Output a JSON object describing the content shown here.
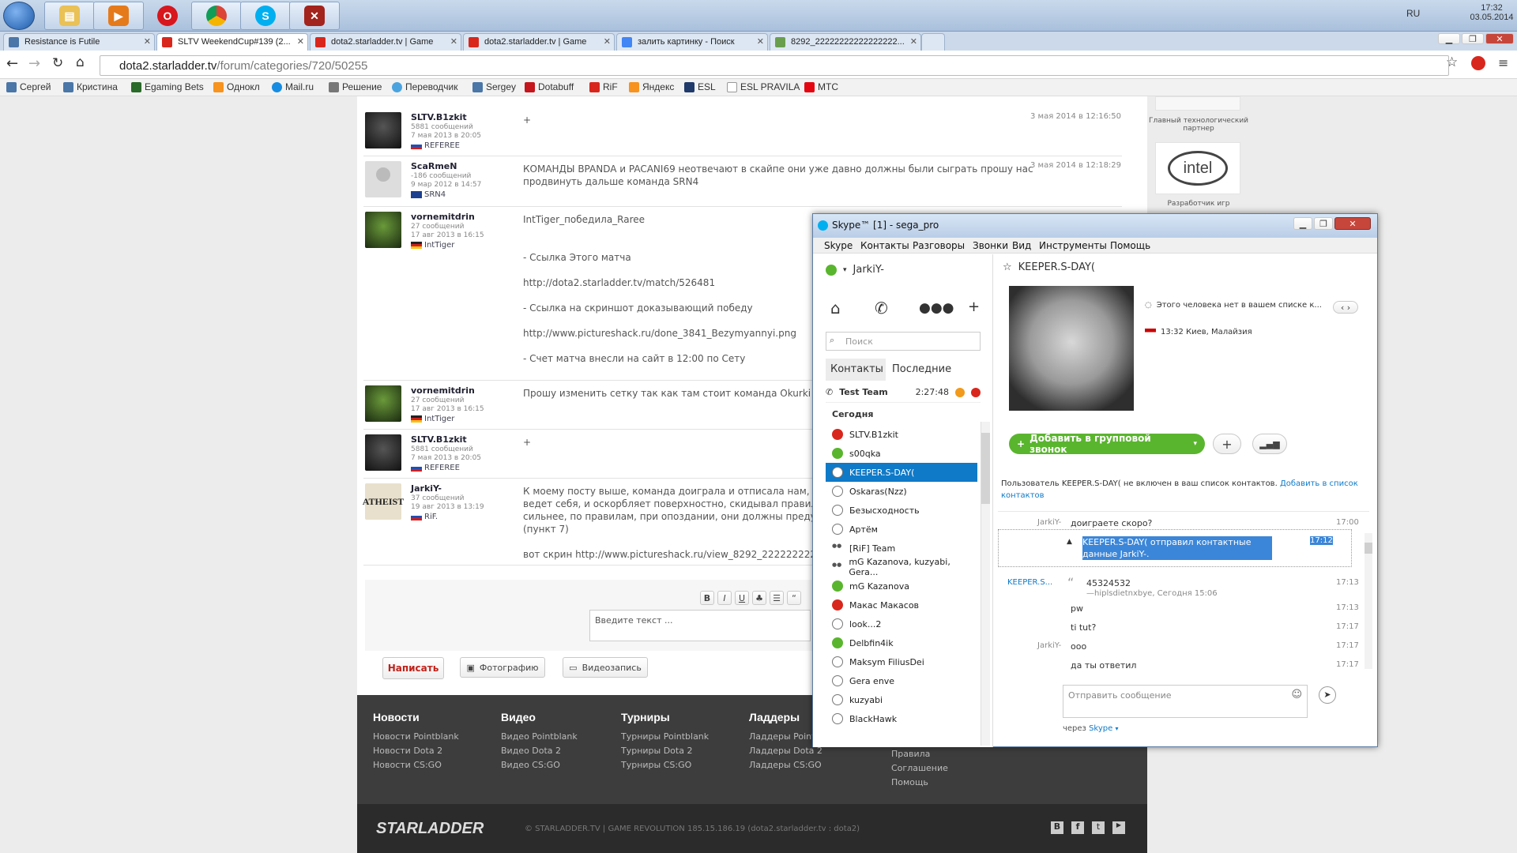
{
  "taskbar": {
    "lang": "RU",
    "time": "17:32",
    "date": "03.05.2014"
  },
  "tabs": [
    {
      "label": "Resistance is Futile"
    },
    {
      "label": "SLTV WeekendCup#139 (2..."
    },
    {
      "label": "dota2.starladder.tv | Game"
    },
    {
      "label": "dota2.starladder.tv | Game"
    },
    {
      "label": "залить картинку - Поиск"
    },
    {
      "label": "8292_22222222222222222..."
    }
  ],
  "address": {
    "host": "dota2.starladder.tv",
    "path": "/forum/categories/720/50255"
  },
  "bookmarks": [
    "Сергей",
    "Кристина",
    "Egaming Bets",
    "Однокл",
    "Mail.ru",
    "Решение",
    "Переводчик",
    "Sergey",
    "Dotabuff",
    "RiF",
    "Яндекс",
    "ESL",
    "ESL PRAVILA",
    "MTC"
  ],
  "sidebar": {
    "partner1": "Главный технологический партнер",
    "partner2": "Разработчик игр"
  },
  "posts": [
    {
      "user": "SLTV.B1zkit",
      "count": "5881 сообщений",
      "date": "7 мая 2013 в 20:05",
      "team": "REFEREE",
      "text": "+",
      "posted": "3 мая 2014 в 12:16:50"
    },
    {
      "user": "ScaRmeN",
      "count": "-186 сообщений",
      "date": "9 мар 2012 в 14:57",
      "team": "SRN4",
      "text": "КОМАНДЫ BPANDA и PACANI69 неотвечают в скайпе они уже давно должны были сыграть прошу нас\nпродвинуть дальше команда SRN4",
      "posted": "3 мая 2014 в 12:18:29"
    },
    {
      "user": "vornemitdrin",
      "count": "27 сообщений",
      "date": "17 авг 2013 в 16:15",
      "team": "IntTiger",
      "text": "IntTiger_победила_Raree\n\n\n- Ссылка Этого матча\n\nhttp://dota2.starladder.tv/match/526481\n\n- Ссылка на скриншот доказывающий победу\n\nhttp://www.pictureshack.ru/done_3841_Bezymyannyi.png\n\n- Счет матча внесли на сайт в 12:00 по Сету",
      "posted": ""
    },
    {
      "user": "vornemitdrin",
      "count": "27 сообщений",
      "date": "17 авг 2013 в 16:15",
      "team": "IntTiger",
      "text": "Прошу изменить сетку так как там стоит команда Okurki",
      "posted": ""
    },
    {
      "user": "SLTV.B1zkit",
      "count": "5881 сообщений",
      "date": "7 мая 2013 в 20:05",
      "team": "REFEREE",
      "text": "+",
      "posted": ""
    },
    {
      "user": "JarkiY-",
      "count": "37 сообщений",
      "date": "19 авг 2013 в 13:19",
      "team": "RiF.",
      "text": "К моему посту выше, команда доиграла и отписала нам, когда у\nведет себя, и оскорбляет поверхностно, скидывал правила ем\nсильнее, по правилам, при опоздании, они должны предупред\n(пункт 7)\n\nвот скрин http://www.pictureshack.ru/view_8292_2222222222",
      "posted": ""
    }
  ],
  "editor": {
    "placeholder": "Введите текст ...",
    "submit": "Написать",
    "photo": "Фотографию",
    "video": "Видеозапись"
  },
  "footer": {
    "cols": [
      {
        "title": "Новости",
        "items": [
          "Новости Pointblank",
          "Новости Dota 2",
          "Новости CS:GO"
        ]
      },
      {
        "title": "Видео",
        "items": [
          "Видео Pointblank",
          "Видео Dota 2",
          "Видео CS:GO"
        ]
      },
      {
        "title": "Турниры",
        "items": [
          "Турниры Pointblank",
          "Турниры Dota 2",
          "Турниры CS:GO"
        ]
      },
      {
        "title": "Ладдеры",
        "items": [
          "Ладдеры Pointblank",
          "Ладдеры Dota 2",
          "Ладдеры CS:GO"
        ]
      }
    ],
    "extra": [
      "Правила",
      "Соглашение",
      "Помощь"
    ],
    "copyright": "© STARLADDER.TV | GAME REVOLUTION 185.15.186.19 (dota2.starladder.tv : dota2)",
    "logo": "STARLADDER"
  },
  "skype": {
    "title": "Skype™ [1] - sega_pro",
    "menu": [
      "Skype",
      "Контакты",
      "Разговоры",
      "Звонки",
      "Вид",
      "Инструменты",
      "Помощь"
    ],
    "me": "JarkiY-",
    "search_placeholder": "Поиск",
    "tab_contacts": "Контакты",
    "tab_recent": "Последние",
    "group": {
      "name": "Test Team",
      "time": "2:27:48"
    },
    "today": "Сегодня",
    "contacts": [
      {
        "name": "SLTV.B1zkit",
        "status": "red"
      },
      {
        "name": "s00qka",
        "status": "green"
      },
      {
        "name": "KEEPER.S-DAY(",
        "status": "unknown"
      },
      {
        "name": "Oskaras(Nzz)",
        "status": "unknown"
      },
      {
        "name": "Безысходность",
        "status": "unknown"
      },
      {
        "name": "Артём",
        "status": "unknown"
      },
      {
        "name": "[RiF] Team",
        "status": "group"
      },
      {
        "name": "mG Kazanova, kuzyabi, Gera...",
        "status": "group"
      },
      {
        "name": "mG Kazanova",
        "status": "green"
      },
      {
        "name": "Макас Макасов",
        "status": "red"
      },
      {
        "name": "look...2",
        "status": "unknown"
      },
      {
        "name": "Delbfin4ik",
        "status": "green"
      },
      {
        "name": "Maksym FiliusDei",
        "status": "unknown"
      },
      {
        "name": "Gera enve",
        "status": "unknown"
      },
      {
        "name": "kuzyabi",
        "status": "unknown"
      },
      {
        "name": "BlackHawk",
        "status": "unknown"
      }
    ],
    "chat": {
      "name": "KEEPER.S-DAY(",
      "notice_top": "Этого человека нет в вашем списке к...",
      "location": "13:32 Киев, Малайзия",
      "add_call": "Добавить в групповой звонок",
      "notice": "Пользователь KEEPER.S-DAY( не включен в ваш список контактов.",
      "add_link": "Добавить в список контактов",
      "messages": [
        {
          "sender": "JarkiY-",
          "text": "доиграете скоро?",
          "time": "17:00"
        },
        {
          "sender": "",
          "text": "KEEPER.S-DAY( отправил контактные данные JarkiY-.",
          "time": "17:12"
        },
        {
          "sender": "KEEPER.S...",
          "text": "45324532",
          "quote": "—hiplsdietnxbye, Сегодня 15:06",
          "time": "17:13"
        },
        {
          "sender": "",
          "text": "pw",
          "time": "17:13"
        },
        {
          "sender": "",
          "text": "ti tut?",
          "time": "17:17"
        },
        {
          "sender": "JarkiY-",
          "text": "ooo",
          "time": "17:17"
        },
        {
          "sender": "",
          "text": "да ты ответил",
          "time": "17:17"
        }
      ],
      "input_placeholder": "Отправить сообщение",
      "via": "через",
      "via_link": "Skype"
    }
  },
  "colors": {
    "accent": "#0f7ac8",
    "green": "#5ab52e",
    "red": "#d9261c"
  }
}
